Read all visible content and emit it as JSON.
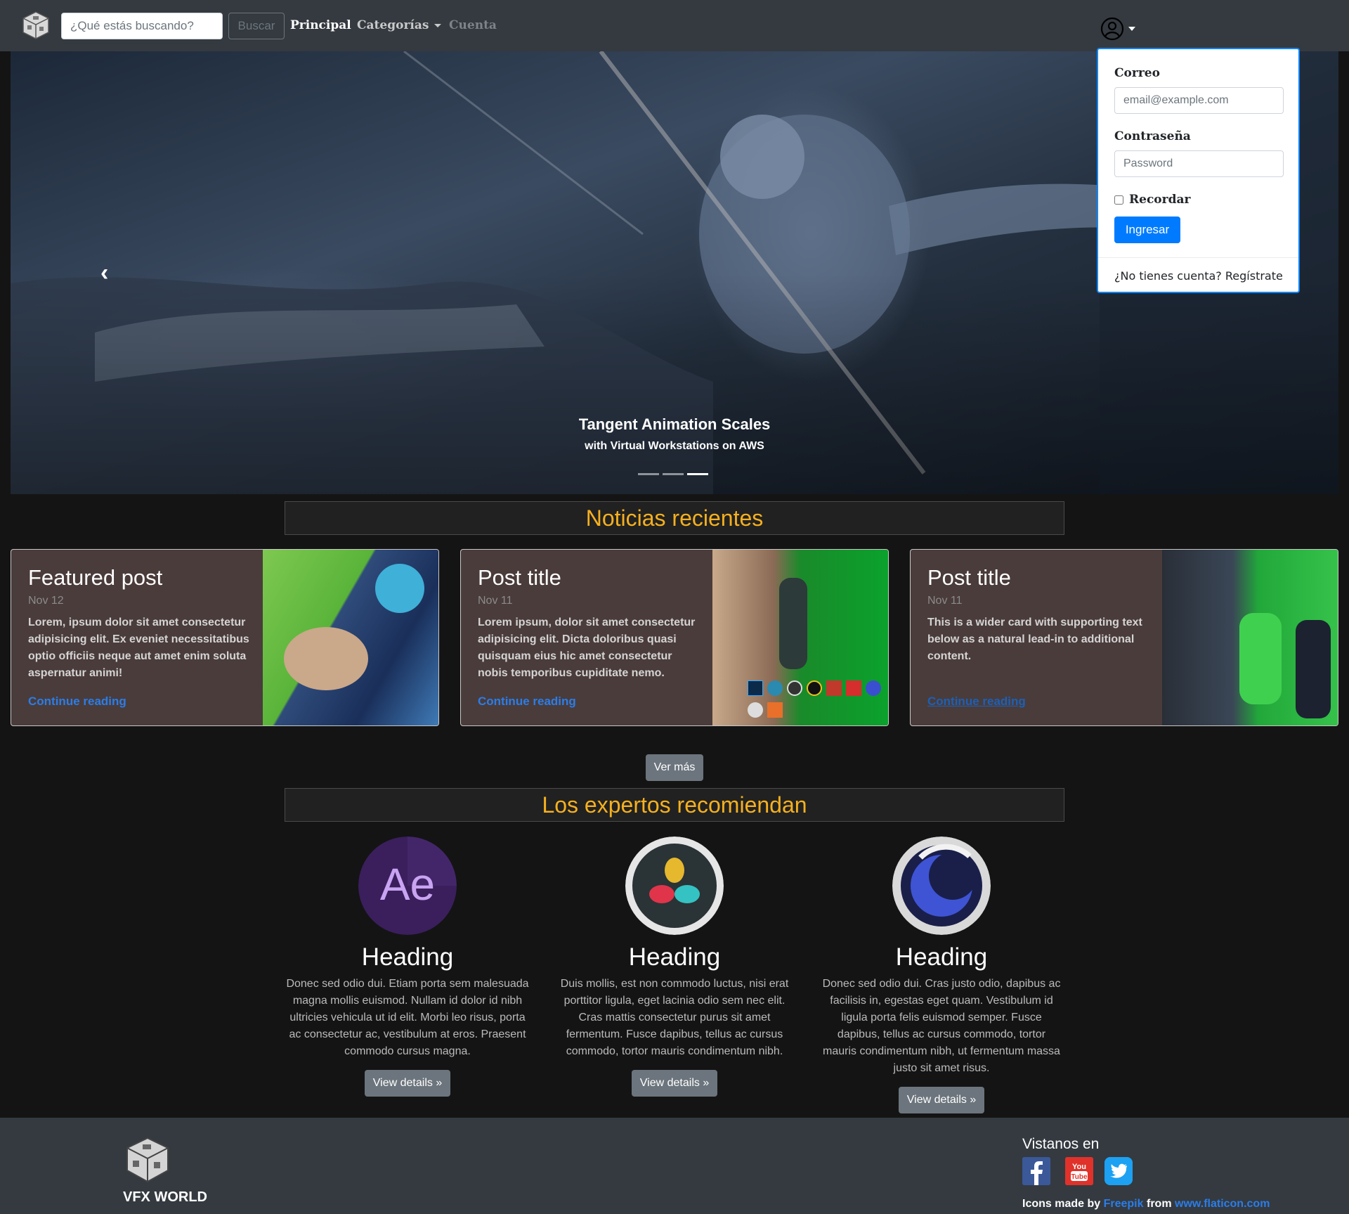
{
  "navbar": {
    "search_placeholder": "¿Qué estás buscando?",
    "search_button": "Buscar",
    "links": [
      "Principal",
      "Categorías",
      "Cuenta"
    ]
  },
  "login": {
    "email_label": "Correo",
    "email_placeholder": "email@example.com",
    "password_label": "Contraseña",
    "password_placeholder": "Password",
    "remember_label": "Recordar",
    "submit_label": "Ingresar",
    "register_text": "¿No tienes cuenta? Regístrate"
  },
  "carousel": {
    "caption_title": "Tangent Animation Scales",
    "caption_subtitle": "with Virtual Workstations on AWS",
    "slide_count": 3,
    "active_slide": 3
  },
  "news": {
    "heading": "Noticias recientes",
    "cards": [
      {
        "title": "Featured post",
        "date": "Nov 12",
        "text": "Lorem, ipsum dolor sit amet consectetur adipisicing elit. Ex eveniet necessitatibus optio officiis neque aut amet enim soluta aspernatur animi!",
        "link": "Continue reading"
      },
      {
        "title": "Post title",
        "date": "Nov 11",
        "text": "Lorem ipsum, dolor sit amet consectetur adipisicing elit. Dicta doloribus quasi quisquam eius hic amet consectetur nobis temporibus cupiditate nemo.",
        "link": "Continue reading"
      },
      {
        "title": "Post title",
        "date": "Nov 11",
        "text": "This is a wider card with supporting text below as a natural lead-in to additional content.",
        "link": "Continue reading"
      }
    ],
    "more_button": "Ver más"
  },
  "experts": {
    "heading": "Los expertos recomiendan",
    "items": [
      {
        "icon": "after-effects-icon",
        "heading": "Heading",
        "text": "Donec sed odio dui. Etiam porta sem malesuada magna mollis euismod. Nullam id dolor id nibh ultricies vehicula ut id elit. Morbi leo risus, porta ac consectetur ac, vestibulum at eros. Praesent commodo cursus magna.",
        "button": "View details »"
      },
      {
        "icon": "davinci-resolve-icon",
        "heading": "Heading",
        "text": "Duis mollis, est non commodo luctus, nisi erat porttitor ligula, eget lacinia odio sem nec elit. Cras mattis consectetur purus sit amet fermentum. Fusce dapibus, tellus ac cursus commodo, tortor mauris condimentum nibh.",
        "button": "View details »"
      },
      {
        "icon": "cinema4d-icon",
        "heading": "Heading",
        "text": "Donec sed odio dui. Cras justo odio, dapibus ac facilisis in, egestas eget quam. Vestibulum id ligula porta felis euismod semper. Fusce dapibus, tellus ac cursus commodo, tortor mauris condimentum nibh, ut fermentum massa justo sit amet risus.",
        "button": "View details »"
      }
    ]
  },
  "footer": {
    "brand": "VFX WORLD",
    "follow_title": "Vistanos en",
    "credits_prefix": "Icons made by",
    "credits_author": "Freepik",
    "credits_from": "from",
    "credits_site": "www.flaticon.com"
  },
  "colors": {
    "accent": "#f5b01f",
    "link": "#2b7de9",
    "primary_button": "#007bff",
    "secondary_button": "#6c757d",
    "navbar": "#343a40",
    "card_bg": "#4a3c3b"
  }
}
